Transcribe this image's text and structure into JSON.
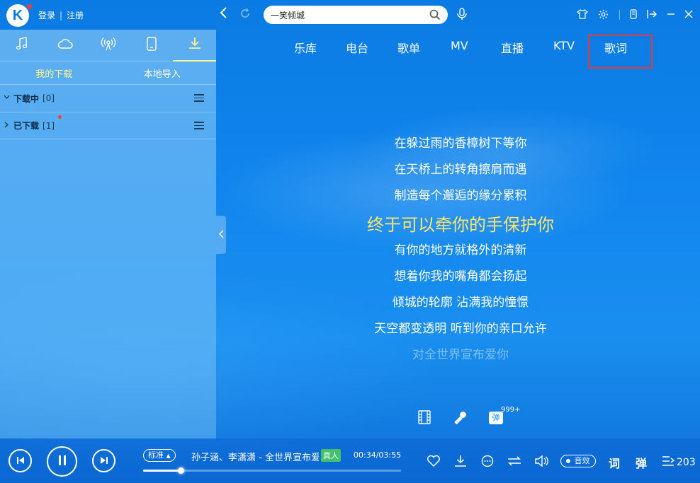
{
  "app": {
    "logo_letter": "K",
    "login": "登录",
    "register": "注册"
  },
  "search": {
    "value": "一笑倾城"
  },
  "sidebar": {
    "tabs": [
      "music-note-icon",
      "cloud-icon",
      "radio-icon",
      "phone-icon",
      "download-icon"
    ],
    "subtabs": [
      {
        "label": "我的下载",
        "active": true
      },
      {
        "label": "本地导入",
        "active": false
      }
    ],
    "groups": [
      {
        "title": "下载中",
        "count": "[0]"
      },
      {
        "title": "已下载",
        "count": "[1]"
      }
    ]
  },
  "nav": {
    "items": [
      "乐库",
      "电台",
      "歌单",
      "MV",
      "直播",
      "KTV",
      "歌词"
    ],
    "active_index": 6
  },
  "lyrics": {
    "lines": [
      "在躲过雨的香樟树下等你",
      "在天桥上的转角擦肩而遇",
      "制造每个邂逅的缘分累积",
      "终于可以牵你的手保护你",
      "有你的地方就格外的清新",
      "想着你我的嘴角都会扬起",
      "倾城的轮廓 沾满我的憧憬",
      "天空都变透明 听到你的亲口允许",
      "对全世界宣布爱你"
    ],
    "current_index": 3,
    "danmu_label": "弹",
    "danmu_count": "999+"
  },
  "player": {
    "quality": "标准",
    "song": "孙子涵、李潇潇 - 全世界宣布爱你",
    "real_tag": "真人",
    "time": "00:34/03:55",
    "progress": 0.145,
    "effect": "音效",
    "lyric_btn": "词",
    "danmu_btn": "弹",
    "queue_count": "203"
  },
  "colors": {
    "accent_yellow": "#ffe46a",
    "highlight_red": "#e53b3b",
    "tag_green": "#44c16a"
  }
}
